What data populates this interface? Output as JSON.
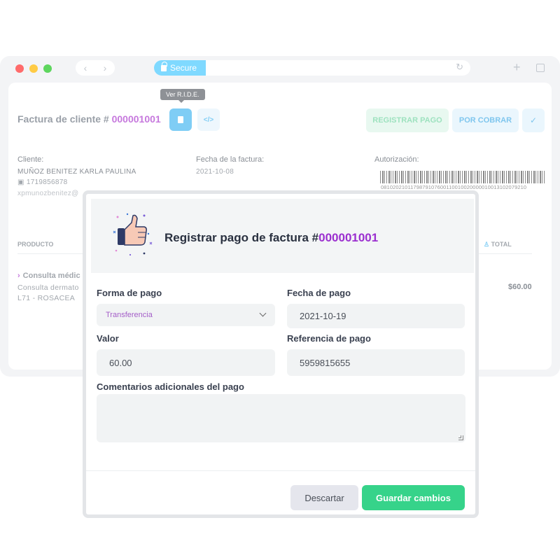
{
  "browser": {
    "secure_label": "Secure",
    "controls": {
      "close_color": "#ff6b6b",
      "minimize_color": "#ffcb45",
      "maximize_color": "#5ed65e"
    }
  },
  "invoice": {
    "title_prefix": "Factura de cliente # ",
    "number": "000001001",
    "tooltip": "Ver R.I.D.E.",
    "buttons": {
      "registrar": "REGISTRAR PAGO",
      "cobrar": "POR COBRAR"
    },
    "cliente_label": "Cliente:",
    "cliente_name": "MUÑOZ BENITEZ KARLA PAULINA",
    "cliente_id": "1719856878",
    "cliente_email": "xpmunozbenitez@",
    "fecha_label": "Fecha de la factura:",
    "fecha_value": "2021-10-08",
    "autorizacion_label": "Autorización:",
    "autorizacion_value": "0810202101179879107600110010020000010013102079210",
    "table": {
      "col_producto": "PRODUCTO",
      "col_total": "TOTAL",
      "row_title": "Consulta médic",
      "row_desc": "Consulta dermato",
      "row_code": "L71 - ROSACEA",
      "row_total": "$60.00"
    }
  },
  "modal": {
    "title_prefix": "Registrar pago de factura #",
    "number": "000001001",
    "forma_label": "Forma de pago",
    "forma_value": "Transferencia",
    "fecha_label": "Fecha de pago",
    "fecha_value": "2021-10-19",
    "valor_label": "Valor",
    "valor_value": "60.00",
    "referencia_label": "Referencia de pago",
    "referencia_value": "5959815655",
    "comentarios_label": "Comentarios adicionales del pago",
    "comentarios_value": "",
    "descartar_label": "Descartar",
    "guardar_label": "Guardar cambios"
  }
}
